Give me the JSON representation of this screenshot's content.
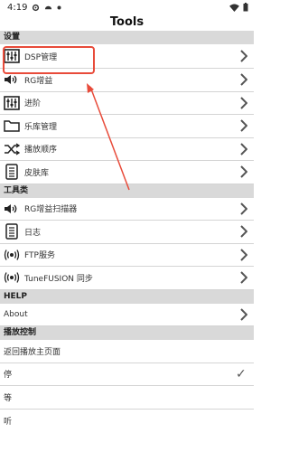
{
  "status_bar": {
    "time": "4:19",
    "icons": [
      "settings-gear-icon",
      "android-icon",
      "dot-icon",
      "wifi-icon",
      "battery-icon"
    ]
  },
  "title": "Tools",
  "sections": {
    "settings": {
      "header": "设置",
      "items": [
        {
          "label": "DSP管理",
          "icon": "equalizer-icon"
        },
        {
          "label": "RG增益",
          "icon": "speaker-icon"
        },
        {
          "label": "进阶",
          "icon": "equalizer-icon"
        },
        {
          "label": "乐库管理",
          "icon": "folder-icon"
        },
        {
          "label": "播放顺序",
          "icon": "shuffle-icon"
        },
        {
          "label": "皮肤库",
          "icon": "list-icon"
        }
      ]
    },
    "tools": {
      "header": "工具类",
      "items": [
        {
          "label": "RG增益扫描器",
          "icon": "speaker-icon"
        },
        {
          "label": "日志",
          "icon": "list-icon"
        },
        {
          "label": "FTP服务",
          "icon": "broadcast-icon"
        },
        {
          "label": "TuneFUSION 同步",
          "icon": "broadcast-icon"
        }
      ]
    },
    "help": {
      "header": "HELP",
      "items": [
        {
          "label": "About"
        }
      ]
    },
    "playback": {
      "header": "播放控制",
      "items": [
        {
          "label": "返回播放主页面"
        },
        {
          "label": "停",
          "checked": true
        },
        {
          "label": "等"
        },
        {
          "label": "听"
        }
      ]
    }
  },
  "colors": {
    "highlight": "#e84b3a",
    "section_bg": "#d9d9d9"
  }
}
